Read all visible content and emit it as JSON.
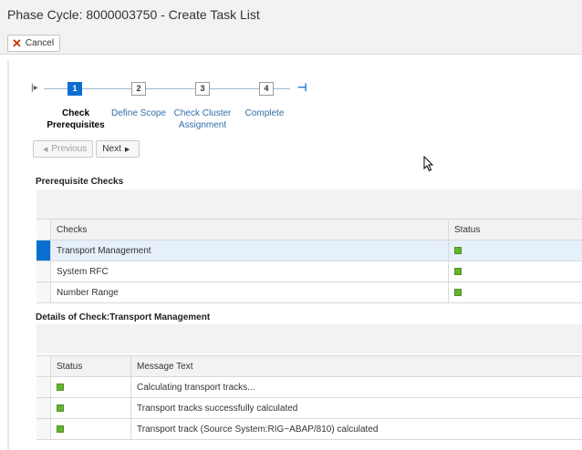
{
  "window": {
    "title": "Phase Cycle: 8000003750 - Create Task List"
  },
  "toolbar": {
    "cancel_label": "Cancel"
  },
  "wizard": {
    "steps": [
      {
        "number": "1",
        "label_line1": "Check",
        "label_line2": "Prerequisites",
        "active": true
      },
      {
        "number": "2",
        "label_line1": "Define Scope",
        "label_line2": "",
        "active": false
      },
      {
        "number": "3",
        "label_line1": "Check Cluster",
        "label_line2": "Assignment",
        "active": false
      },
      {
        "number": "4",
        "label_line1": "Complete",
        "label_line2": "",
        "active": false
      }
    ],
    "previous_label": "Previous",
    "next_label": "Next"
  },
  "prereq": {
    "title": "Prerequisite Checks",
    "columns": {
      "checks": "Checks",
      "status": "Status"
    },
    "rows": [
      {
        "check": "Transport Management",
        "status": "green"
      },
      {
        "check": "System RFC",
        "status": "green"
      },
      {
        "check": "Number Range",
        "status": "green"
      }
    ]
  },
  "details": {
    "title": "Details of Check:Transport Management",
    "columns": {
      "status": "Status",
      "message": "Message Text"
    },
    "rows": [
      {
        "status": "green",
        "message": "Calculating transport tracks..."
      },
      {
        "status": "green",
        "message": "Transport tracks successfully calculated"
      },
      {
        "status": "green",
        "message": "Transport track (Source System:RIG~ABAP/810) calculated"
      }
    ]
  },
  "colors": {
    "accent": "#0a6ed1",
    "success": "#64b32f"
  }
}
